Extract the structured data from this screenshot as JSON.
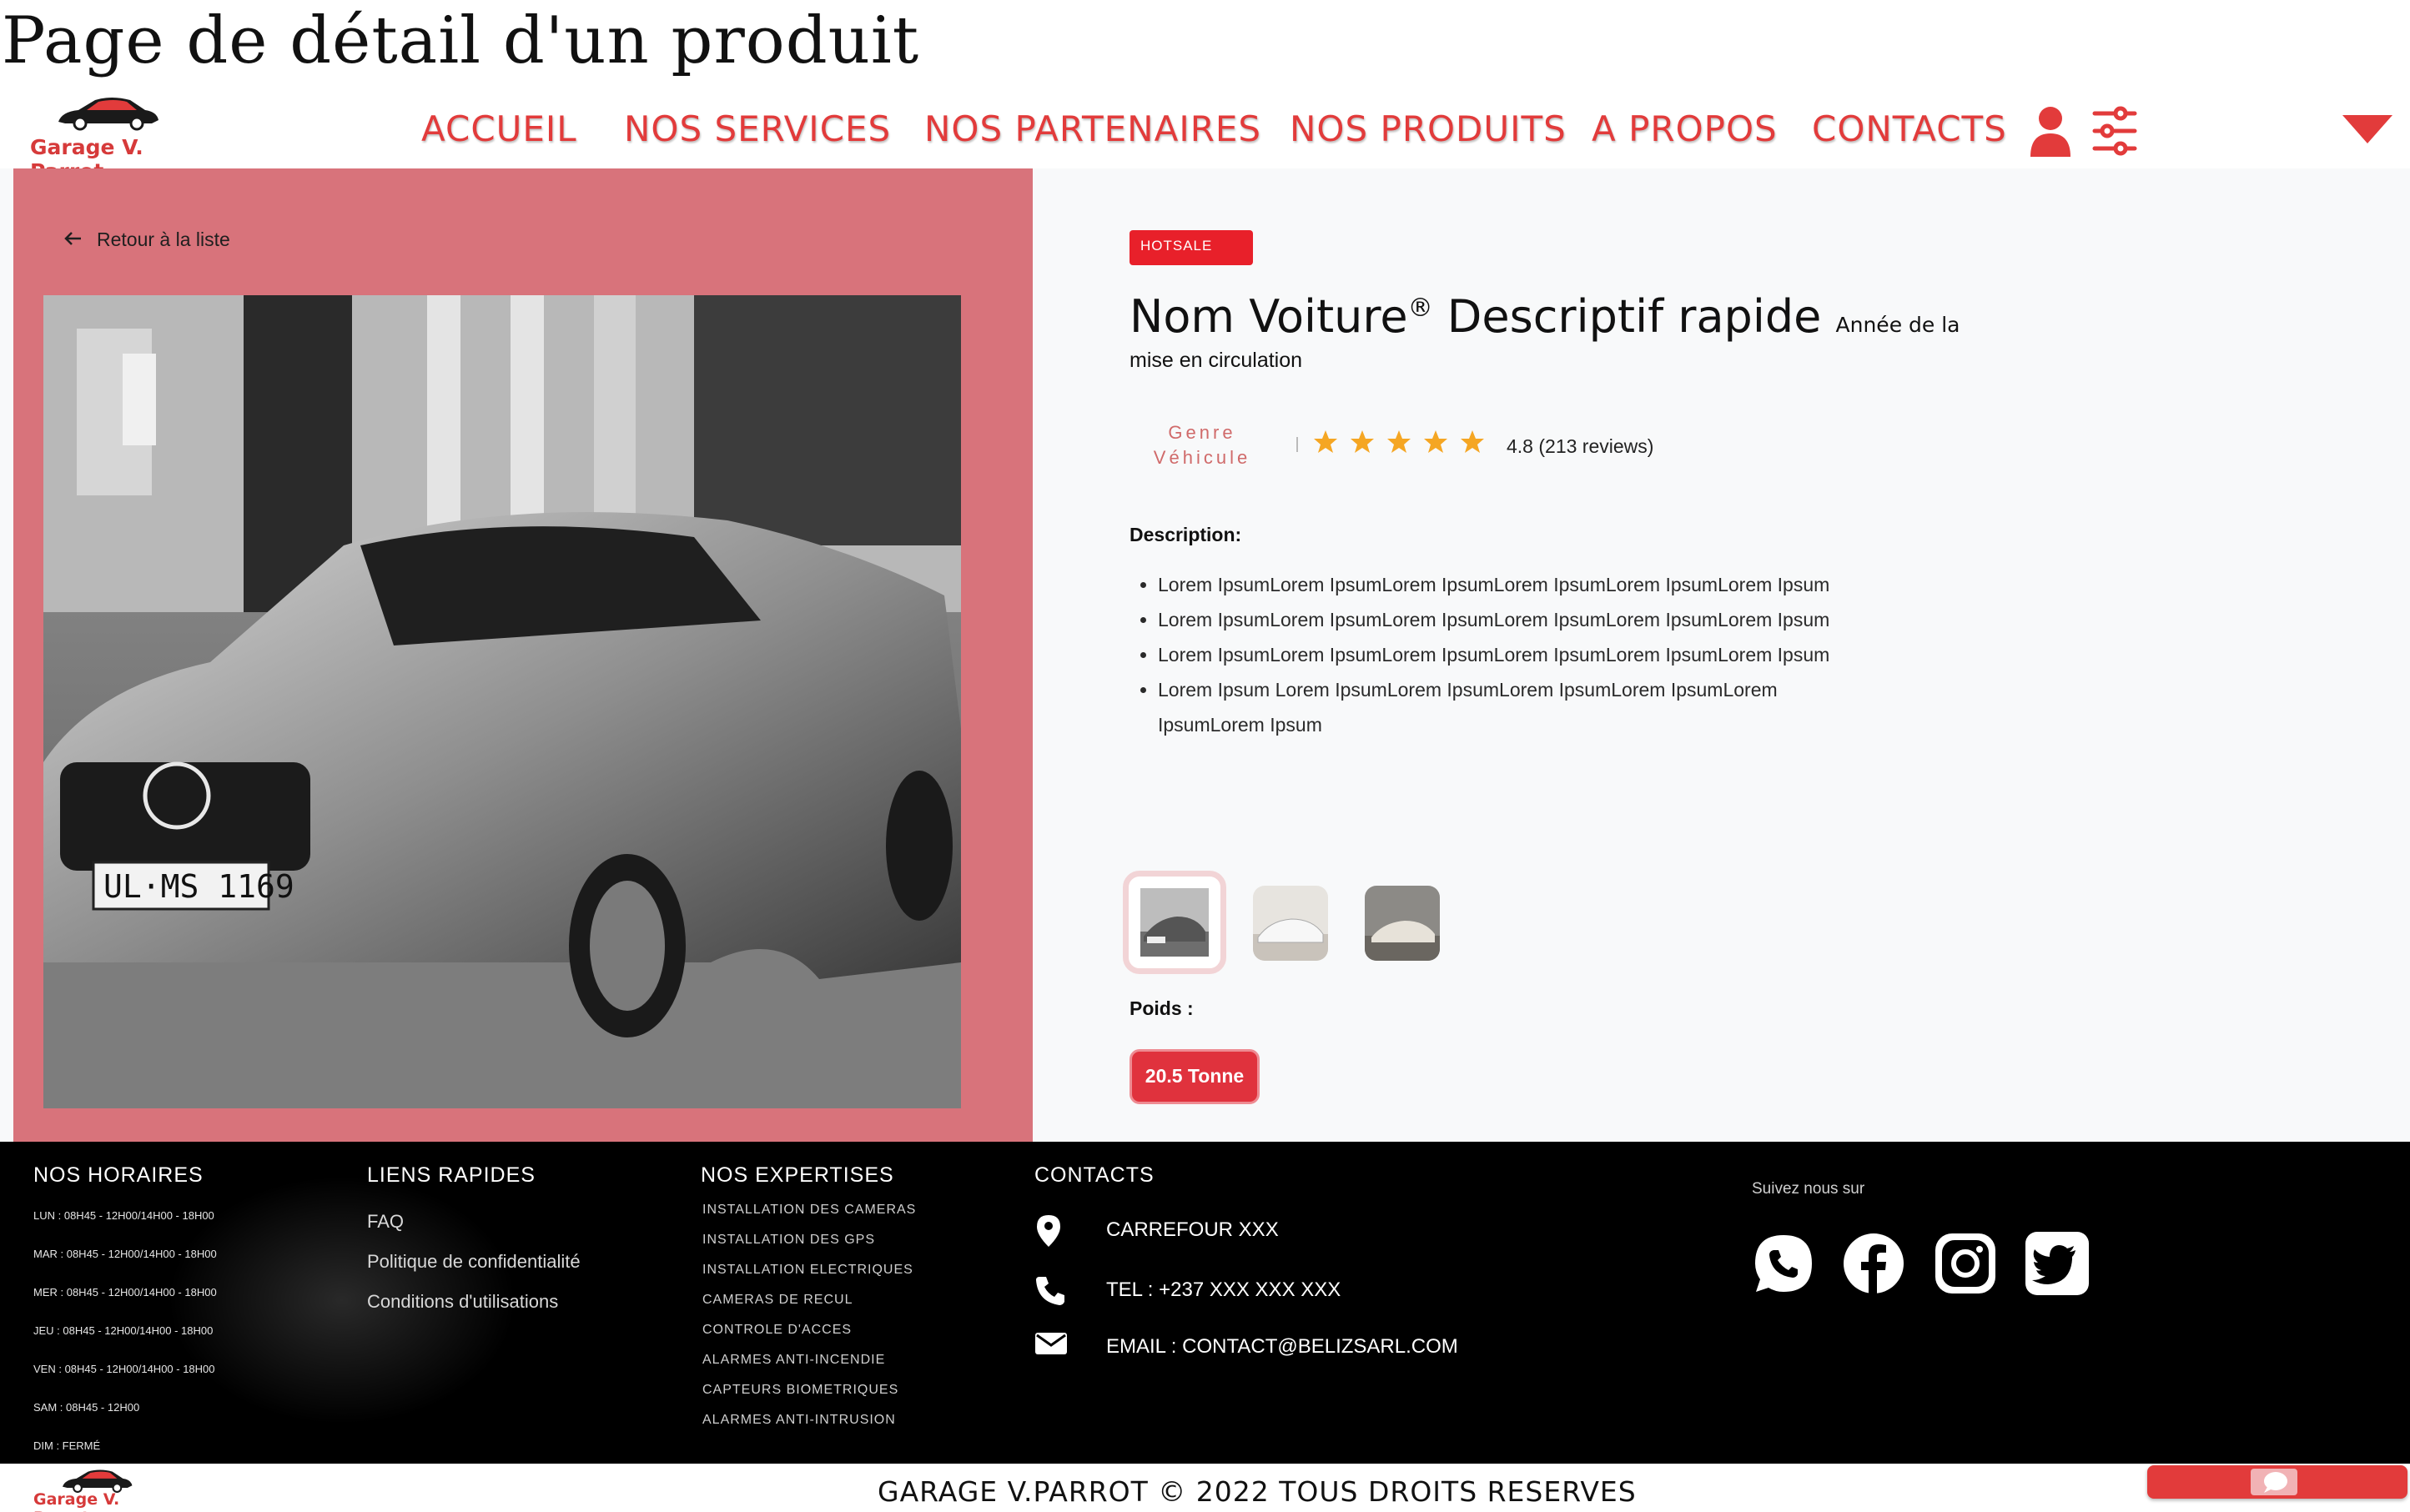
{
  "page_heading": "Page de détail d'un produit",
  "brand": {
    "name": "Garage V. Parrot",
    "accent": "#e23b3b"
  },
  "nav": {
    "links": [
      "ACCUEIL",
      "NOS SERVICES",
      "NOS PARTENAIRES",
      "NOS PRODUITS",
      "A PROPOS",
      "CONTACTS"
    ],
    "icons": [
      "user-icon",
      "filter-sliders-icon",
      "caret-down-icon"
    ]
  },
  "product": {
    "back_label": "Retour à la liste",
    "badge": "HOTSALE",
    "title": "Nom Voiture",
    "trademark": "®",
    "title_rest": "Descriptif rapide",
    "title_small": "Année de la",
    "subtitle": "mise en circulation",
    "genre": "Genre Véhicule",
    "rating": {
      "stars": 5,
      "text": "4.8 (213 reviews)"
    },
    "description_label": "Description:",
    "description": [
      "Lorem IpsumLorem IpsumLorem IpsumLorem IpsumLorem IpsumLorem Ipsum",
      "Lorem IpsumLorem IpsumLorem IpsumLorem IpsumLorem IpsumLorem Ipsum",
      "Lorem IpsumLorem IpsumLorem IpsumLorem IpsumLorem IpsumLorem Ipsum",
      "Lorem Ipsum Lorem IpsumLorem IpsumLorem IpsumLorem IpsumLorem IpsumLorem Ipsum"
    ],
    "weight_label": "Poids :",
    "weight_value": "20.5 Tonne"
  },
  "footer": {
    "hours_title": "NOS HORAIRES",
    "hours": [
      "LUN : 08H45 - 12H00/14H00 - 18H00",
      "MAR : 08H45 - 12H00/14H00 - 18H00",
      "MER : 08H45 - 12H00/14H00 - 18H00",
      "JEU : 08H45 - 12H00/14H00 - 18H00",
      "VEN : 08H45 - 12H00/14H00 - 18H00",
      "SAM : 08H45 - 12H00",
      "DIM : FERMÉ"
    ],
    "links_title": "LIENS RAPIDES",
    "links": [
      "FAQ",
      "Politique de confidentialité",
      "Conditions d'utilisations"
    ],
    "expertise_title": "NOS EXPERTISES",
    "expertises": [
      "INSTALLATION DES CAMERAS",
      "INSTALLATION DES GPS",
      "INSTALLATION ELECTRIQUES",
      "CAMERAS DE RECUL",
      "CONTROLE D'ACCES",
      "ALARMES ANTI-INCENDIE",
      "CAPTEURS BIOMETRIQUES",
      "ALARMES ANTI-INTRUSION"
    ],
    "contacts_title": "CONTACTS",
    "address": "CARREFOUR XXX",
    "phone": "TEL : +237 XXX XXX XXX",
    "email": "EMAIL : CONTACT@BELIZSARL.COM",
    "follow_label": "Suivez nous sur",
    "social": [
      "whatsapp-icon",
      "facebook-icon",
      "instagram-icon",
      "twitter-icon"
    ]
  },
  "copyright": "GARAGE V.PARROT © 2022 TOUS DROITS RESERVES"
}
